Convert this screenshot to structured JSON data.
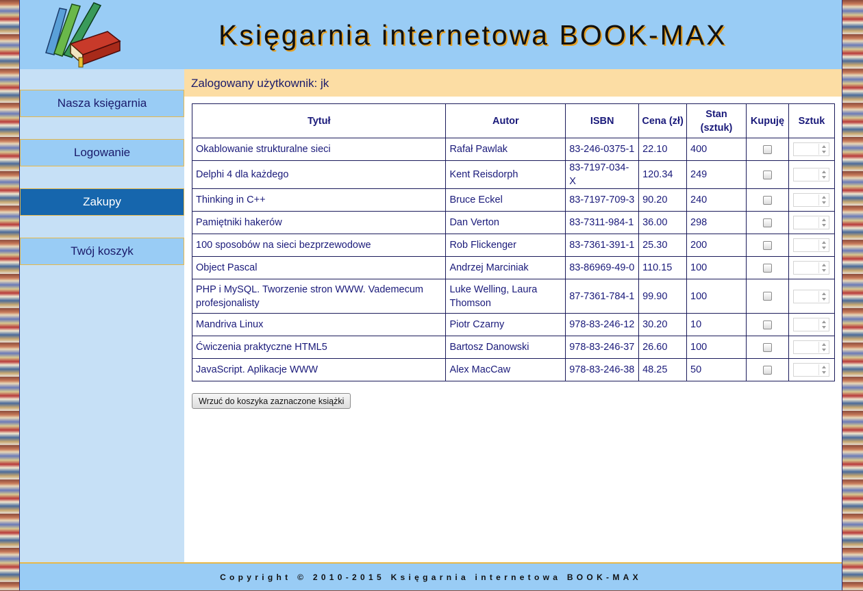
{
  "header": {
    "title": "Księgarnia internetowa BOOK-MAX"
  },
  "sidebar": {
    "items": [
      {
        "label": "Nasza księgarnia",
        "active": false
      },
      {
        "label": "Logowanie",
        "active": false
      },
      {
        "label": "Zakupy",
        "active": true
      },
      {
        "label": "Twój koszyk",
        "active": false
      }
    ]
  },
  "main": {
    "user_label": "Zalogowany użytkownik: jk",
    "table": {
      "headers": [
        "Tytuł",
        "Autor",
        "ISBN",
        "Cena (zł)",
        "Stan (sztuk)",
        "Kupuję",
        "Sztuk"
      ],
      "rows": [
        {
          "title": "Okablowanie strukturalne sieci",
          "author": "Rafał Pawlak",
          "isbn": "83-246-0375-1",
          "price": "22.10",
          "stock": "400"
        },
        {
          "title": "Delphi 4 dla każdego",
          "author": "Kent Reisdorph",
          "isbn": "83-7197-034-X",
          "price": "120.34",
          "stock": "249"
        },
        {
          "title": "Thinking in C++",
          "author": "Bruce Eckel",
          "isbn": "83-7197-709-3",
          "price": "90.20",
          "stock": "240"
        },
        {
          "title": "Pamiętniki hakerów",
          "author": "Dan Verton",
          "isbn": "83-7311-984-1",
          "price": "36.00",
          "stock": "298"
        },
        {
          "title": "100 sposobów na sieci bezprzewodowe",
          "author": "Rob Flickenger",
          "isbn": "83-7361-391-1",
          "price": "25.30",
          "stock": "200"
        },
        {
          "title": "Object Pascal",
          "author": "Andrzej Marciniak",
          "isbn": "83-86969-49-0",
          "price": "110.15",
          "stock": "100"
        },
        {
          "title": "PHP i MySQL. Tworzenie stron WWW. Vademecum profesjonalisty",
          "author": "Luke Welling, Laura Thomson",
          "isbn": "87-7361-784-1",
          "price": "99.90",
          "stock": "100"
        },
        {
          "title": "Mandriva Linux",
          "author": "Piotr Czarny",
          "isbn": "978-83-246-12",
          "price": "30.20",
          "stock": "10"
        },
        {
          "title": "Ćwiczenia praktyczne HTML5",
          "author": "Bartosz Danowski",
          "isbn": "978-83-246-37",
          "price": "26.60",
          "stock": "100"
        },
        {
          "title": "JavaScript. Aplikacje WWW",
          "author": "Alex MacCaw",
          "isbn": "978-83-246-38",
          "price": "48.25",
          "stock": "50"
        }
      ]
    },
    "add_button_label": "Wrzuć do koszyka zaznaczone książki"
  },
  "footer": {
    "text": "Copyright © 2010-2015 Księgarnia internetowa BOOK-MAX"
  },
  "colors": {
    "header_bg": "#99ccf5",
    "sidebar_bg": "#c6e0f6",
    "nav_active": "#1666ad",
    "userbar_bg": "#fcdda4",
    "text": "#1a1a7a"
  }
}
